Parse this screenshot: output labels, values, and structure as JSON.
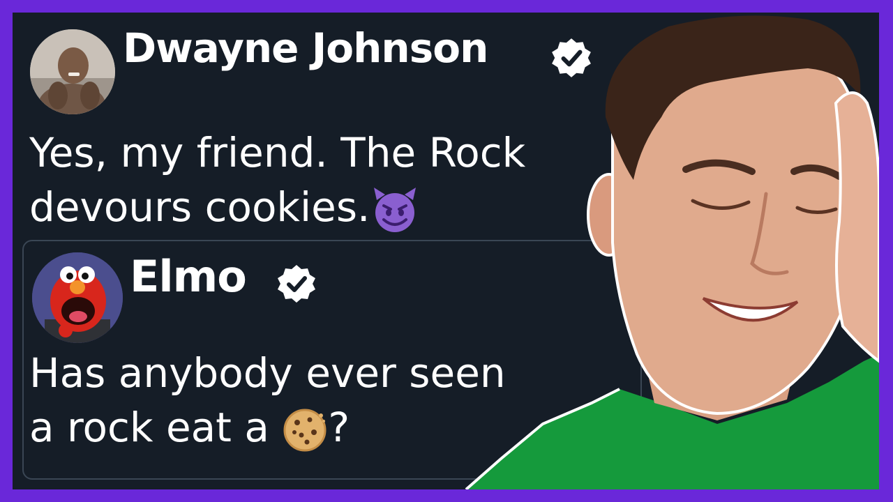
{
  "tweet": {
    "author": "Dwayne Johnson",
    "text_line1": "Yes, my friend. The Rock",
    "text_line2": "devours cookies."
  },
  "quoted_tweet": {
    "author": "Elmo",
    "text_line1": "Has anybody ever seen",
    "text_line2_a": "a rock eat a ",
    "text_line2_b": "?"
  },
  "icons": {
    "verified": "verified-badge-icon",
    "devil": "smiling-devil-emoji-icon",
    "cookie": "cookie-emoji-icon"
  },
  "colors": {
    "border": "#6a28d9",
    "background": "#151d27",
    "text": "#ffffff",
    "shirt": "#159a3c"
  }
}
